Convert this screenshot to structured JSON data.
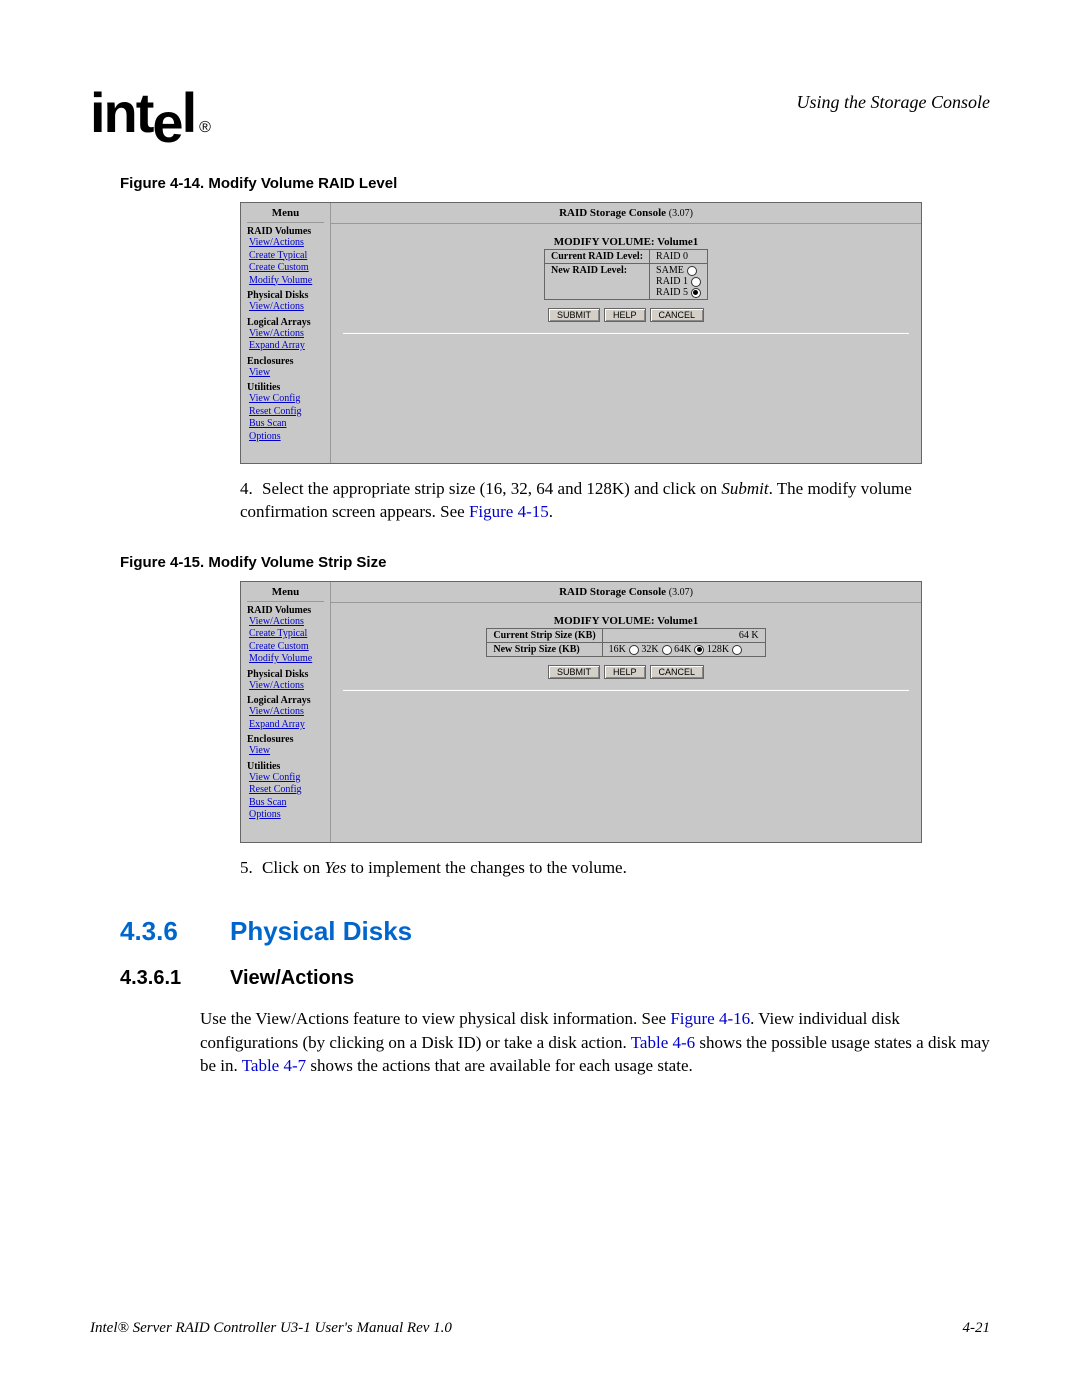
{
  "header": {
    "logo_text": "intel",
    "reg": "®",
    "right": "Using the Storage Console"
  },
  "fig14": {
    "caption": "Figure 4-14. Modify Volume RAID Level",
    "menu_title": "Menu",
    "console_title": "RAID Storage Console",
    "console_ver": "(3.07)",
    "menu": {
      "raid_volumes": "RAID Volumes",
      "view_actions": "View/Actions",
      "create_typical": "Create Typical",
      "create_custom": "Create Custom",
      "modify_volume": "Modify Volume",
      "physical_disks": "Physical Disks",
      "pd_view_actions": "View/Actions",
      "logical_arrays": "Logical Arrays",
      "la_view_actions": "View/Actions",
      "expand_array": "Expand Array",
      "enclosures": "Enclosures",
      "enc_view": "View",
      "utilities": "Utilities",
      "view_config": "View Config",
      "reset_config": "Reset Config",
      "bus_scan": "Bus Scan",
      "options": "Options"
    },
    "form": {
      "title": "MODIFY VOLUME: Volume1",
      "row1_label": "Current RAID Level:",
      "row1_value": "RAID 0",
      "row2_label": "New RAID Level:",
      "opt_same": "SAME",
      "opt_raid1": "RAID 1",
      "opt_raid5": "RAID 5"
    },
    "buttons": {
      "submit": "SUBMIT",
      "help": "HELP",
      "cancel": "CANCEL"
    }
  },
  "step4": {
    "num": "4.",
    "text_a": "Select the appropriate strip size (16, 32, 64 and 128K) and click on ",
    "em": "Submit",
    "text_b": ". The modify volume confirmation screen appears. See ",
    "link": "Figure 4-15",
    "text_c": "."
  },
  "fig15": {
    "caption": "Figure 4-15. Modify Volume Strip Size",
    "menu_title": "Menu",
    "console_title": "RAID Storage Console",
    "console_ver": "(3.07)",
    "menu": {
      "raid_volumes": "RAID Volumes",
      "view_actions": "View/Actions",
      "create_typical": "Create Typical",
      "create_custom": "Create Custom",
      "modify_volume": "Modify Volume",
      "physical_disks": "Physical Disks",
      "pd_view_actions": "View/Actions",
      "logical_arrays": "Logical Arrays",
      "la_view_actions": "View/Actions",
      "expand_array": "Expand Array",
      "enclosures": "Enclosures",
      "enc_view": "View",
      "utilities": "Utilities",
      "view_config": "View Config",
      "reset_config": "Reset Config",
      "bus_scan": "Bus Scan",
      "options": "Options"
    },
    "form": {
      "title": "MODIFY VOLUME: Volume1",
      "row1_label": "Current Strip Size (KB)",
      "row1_value": "64 K",
      "row2_label": "New Strip Size (KB)",
      "opt16": "16K",
      "opt32": "32K",
      "opt64": "64K",
      "opt128": "128K"
    },
    "buttons": {
      "submit": "SUBMIT",
      "help": "HELP",
      "cancel": "CANCEL"
    }
  },
  "step5": {
    "num": "5.",
    "text_a": "Click on ",
    "em": "Yes",
    "text_b": " to implement the changes to the volume."
  },
  "sec436": {
    "num": "4.3.6",
    "title": "Physical Disks"
  },
  "sec4361": {
    "num": "4.3.6.1",
    "title": "View/Actions",
    "para_a": "Use the View/Actions feature to view physical disk information. See ",
    "link1": "Figure 4-16",
    "para_b": ". View individual disk configurations (by clicking on a Disk ID) or take a disk action. ",
    "link2": "Table 4-6",
    "para_c": " shows the possible usage states a disk may be in. ",
    "link3": "Table 4-7",
    "para_d": " shows the actions that are available for each usage state."
  },
  "footer": {
    "left": "Intel® Server RAID Controller U3-1 User's Manual Rev 1.0",
    "right": "4-21"
  }
}
